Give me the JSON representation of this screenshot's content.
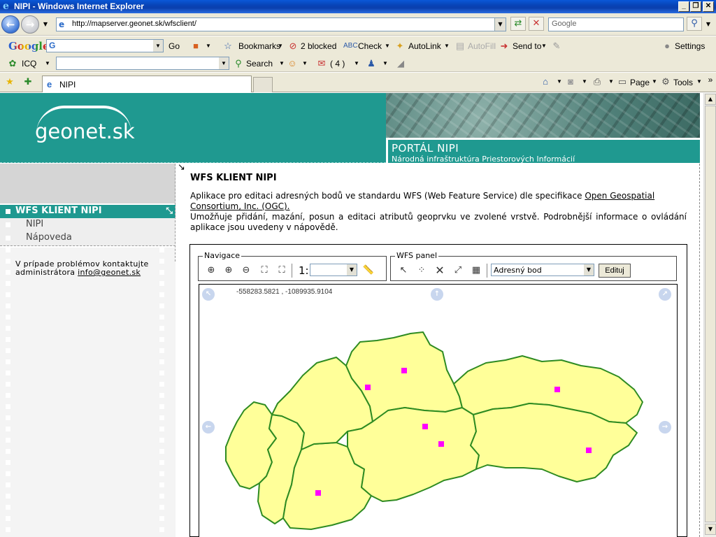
{
  "window": {
    "title": "NIPI - Windows Internet Explorer",
    "min": "_",
    "max": "❐",
    "close": "✕"
  },
  "browser": {
    "url": "http://mapserver.geonet.sk/wfsclient/",
    "search_placeholder": "Google",
    "google_toolbar": {
      "logo": "Google",
      "go": "Go",
      "bookmarks": "Bookmarks",
      "blocked": "2 blocked",
      "check": "Check",
      "autolink": "AutoLink",
      "autofill": "AutoFill",
      "sendto": "Send to",
      "settings": "Settings"
    },
    "icq_toolbar": {
      "icq": "ICQ",
      "search": "Search",
      "count": "( 4 )"
    },
    "tabs": [
      {
        "label": "NIPI"
      }
    ],
    "command_bar": {
      "page": "Page",
      "tools": "Tools"
    }
  },
  "site": {
    "logo": "geonet.sk",
    "portal_title": "PORTÁL NIPI",
    "portal_subtitle": "Národná infraštruktúra Priestorových Informácií"
  },
  "sidebar": {
    "active": "WFS KLIENT NIPI",
    "items": [
      {
        "label": "NIPI"
      },
      {
        "label": "Nápoveda"
      }
    ],
    "contact_line1": "V prípade problémov kontaktujte",
    "contact_line2": "administrátora",
    "contact_email": "info@geonet.sk"
  },
  "main": {
    "heading": "WFS KLIENT NIPI",
    "para1_text": "Aplikace pro editaci adresných bodů ve standardu WFS (Web Feature Service) dle specifikace ",
    "para1_link": "Open Geospatial Consortium, Inc. (OGC).",
    "para2": "Umožňuje přidání, mazání, posun a editaci atributů geoprvku ve zvolené vrstvě. Podrobnější informace o ovládání aplikace jsou uvedeny v nápovědě."
  },
  "app": {
    "nav_legend": "Navigace",
    "wfs_legend": "WFS panel",
    "scale_prefix": "1:",
    "scale_value": "",
    "layer_value": "Adresný bod",
    "edit_button": "Edituj",
    "coords": "-558283.5821 , -1089935.9104"
  },
  "colors": {
    "teal": "#1f9990",
    "map_fill": "#ffff99",
    "map_border": "#2e8b22",
    "point": "#ff00ff"
  }
}
